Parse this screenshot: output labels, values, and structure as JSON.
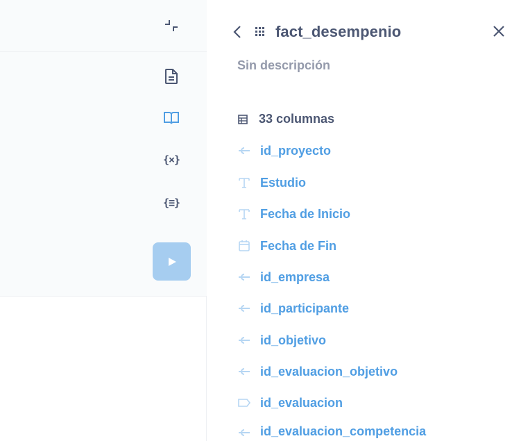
{
  "panel": {
    "title": "fact_desempenio",
    "description": "Sin descripción",
    "column_count_label": "33 columnas"
  },
  "columns": [
    {
      "name": "id_proyecto",
      "type": "fk-icon"
    },
    {
      "name": "Estudio",
      "type": "text-icon"
    },
    {
      "name": "Fecha de Inicio",
      "type": "text-icon"
    },
    {
      "name": "Fecha de Fin",
      "type": "calendar-icon"
    },
    {
      "name": "id_empresa",
      "type": "fk-icon"
    },
    {
      "name": "id_participante",
      "type": "fk-icon"
    },
    {
      "name": "id_objetivo",
      "type": "fk-icon"
    },
    {
      "name": "id_evaluacion_objetivo",
      "type": "fk-icon"
    },
    {
      "name": "id_evaluacion",
      "type": "label-icon"
    },
    {
      "name": "id_evaluacion_competencia",
      "type": "fk-icon"
    }
  ],
  "toolbar": {
    "variables_label": "{×}",
    "snippets_label": "{≡}"
  },
  "colors": {
    "accent": "#509ee3",
    "title": "#4c5773",
    "muted": "#949aab",
    "run_button": "#a6cdf0"
  }
}
